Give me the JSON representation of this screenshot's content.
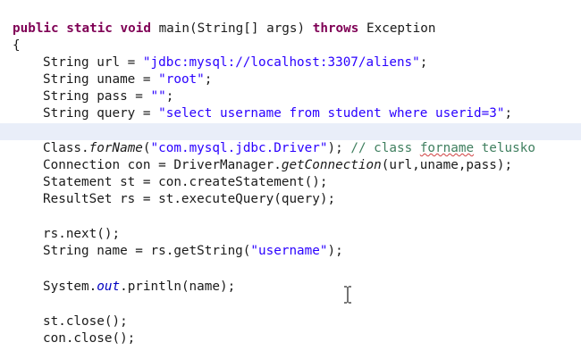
{
  "code": {
    "line1": {
      "kw_public": "public",
      "kw_static": "static",
      "kw_void": "void",
      "sig": "main(String[] args)",
      "kw_throws": "throws",
      "exc": "Exception"
    },
    "line2": "{",
    "url_decl": "String url = ",
    "url_value": "\"jdbc:mysql://localhost:3307/aliens\"",
    "uname_decl": "String uname = ",
    "uname_value": "\"root\"",
    "pass_decl": "String pass = ",
    "pass_value": "\"\"",
    "query_decl": "String query = ",
    "query_value": "\"select username from student where userid=3\"",
    "class_prefix": "Class.",
    "forname_method": "forName",
    "forname_open": "(",
    "driver_value": "\"com.mysql.jdbc.Driver\"",
    "forname_close": ");",
    "comment_prefix": "// class ",
    "comment_forname": "forname",
    "comment_suffix": " telusko",
    "con_decl": "Connection con = DriverManager.",
    "getconnection_method": "getConnection",
    "con_args": "(url,uname,pass);",
    "stmt_line": "Statement st = con.createStatement();",
    "rs_line": "ResultSet rs = st.executeQuery(query);",
    "next_line": "rs.next();",
    "name_decl": "String name = rs.getString(",
    "username_value": "\"username\"",
    "name_close": ");",
    "println_prefix": "System.",
    "println_out": "out",
    "println_suffix": ".println(name);",
    "st_close": "st.close();",
    "con_close": "con.close();"
  },
  "semicolon": ";",
  "cursor_icon": "text-cursor-icon",
  "colors": {
    "keyword": "#7f0055",
    "string": "#2a00ff",
    "comment": "#3f7f5f",
    "current_line": "#e9eef9",
    "static_field": "#0000c0"
  }
}
